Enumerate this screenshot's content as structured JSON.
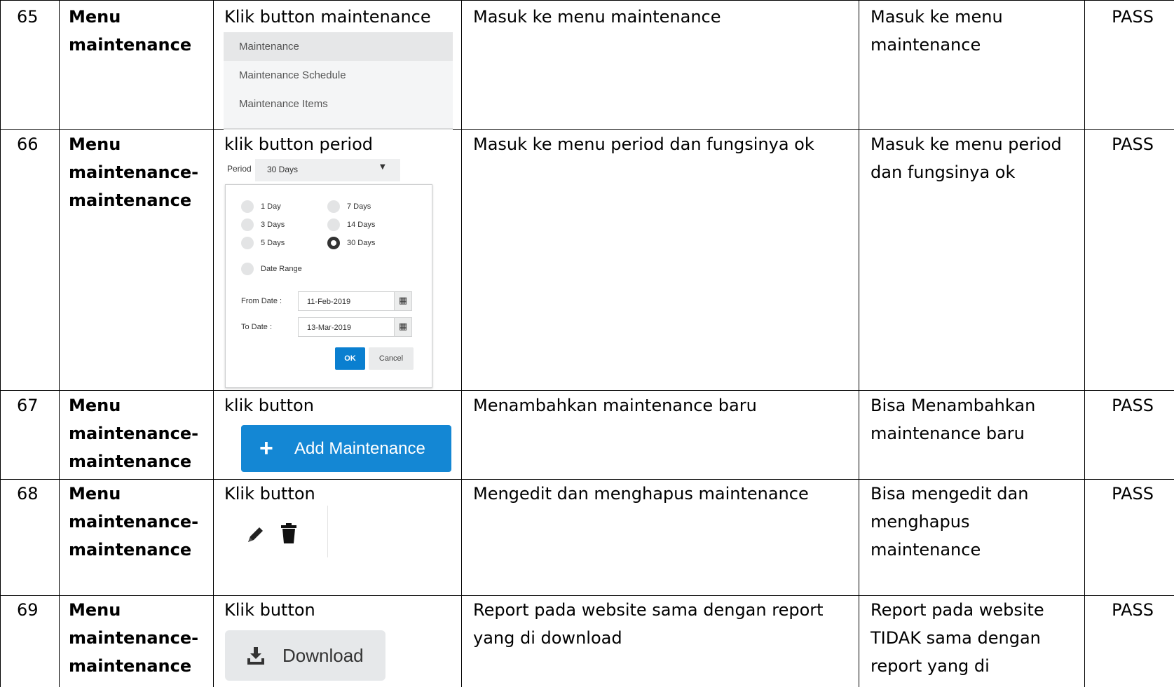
{
  "rows": [
    {
      "no": "65",
      "module": [
        "Menu",
        "maintenance"
      ],
      "step": "Klik button maintenance",
      "expected": [
        "Masuk ke menu maintenance"
      ],
      "actual": [
        "Masuk ke menu",
        "maintenance"
      ],
      "status": "PASS"
    },
    {
      "no": "66",
      "module": [
        "Menu",
        "maintenance-",
        "maintenance"
      ],
      "step": "klik button period",
      "expected": [
        "Masuk ke menu period dan fungsinya ok"
      ],
      "actual": [
        "Masuk ke menu period",
        "dan fungsinya ok"
      ],
      "status": "PASS"
    },
    {
      "no": "67",
      "module": [
        "Menu",
        "maintenance-",
        "maintenance"
      ],
      "step": "klik button",
      "expected": [
        "Menambahkan maintenance baru"
      ],
      "actual": [
        "Bisa Menambahkan",
        "maintenance baru"
      ],
      "status": "PASS"
    },
    {
      "no": "68",
      "module": [
        "Menu",
        "maintenance-",
        "maintenance"
      ],
      "step": "Klik button",
      "expected": [
        "Mengedit dan menghapus maintenance"
      ],
      "actual": [
        "Bisa mengedit dan",
        "menghapus",
        "maintenance"
      ],
      "status": "PASS"
    },
    {
      "no": "69",
      "module": [
        "Menu",
        "maintenance-",
        "maintenance"
      ],
      "step": "Klik button",
      "expected": [
        "Report pada website sama dengan report",
        "yang di download"
      ],
      "actual": [
        "Report pada website",
        "TIDAK sama dengan",
        "report yang di"
      ],
      "status": "PASS"
    }
  ],
  "maintenance_menu": {
    "items": [
      "Maintenance",
      "Maintenance Schedule",
      "Maintenance Items"
    ]
  },
  "period_widget": {
    "label": "Period",
    "selected": "30 Days",
    "options_left": [
      "1 Day",
      "3 Days",
      "5 Days"
    ],
    "options_right": [
      "7 Days",
      "14 Days",
      "30 Days"
    ],
    "date_range": "Date Range",
    "from_label": "From Date :",
    "from_value": "11-Feb-2019",
    "to_label": "To Date :",
    "to_value": "13-Mar-2019",
    "ok": "OK",
    "cancel": "Cancel"
  },
  "add_button": {
    "label": "Add Maintenance"
  },
  "download_button": {
    "label": "Download"
  },
  "colors": {
    "accent": "#1487d4",
    "ok_button": "#0a7fd0"
  }
}
